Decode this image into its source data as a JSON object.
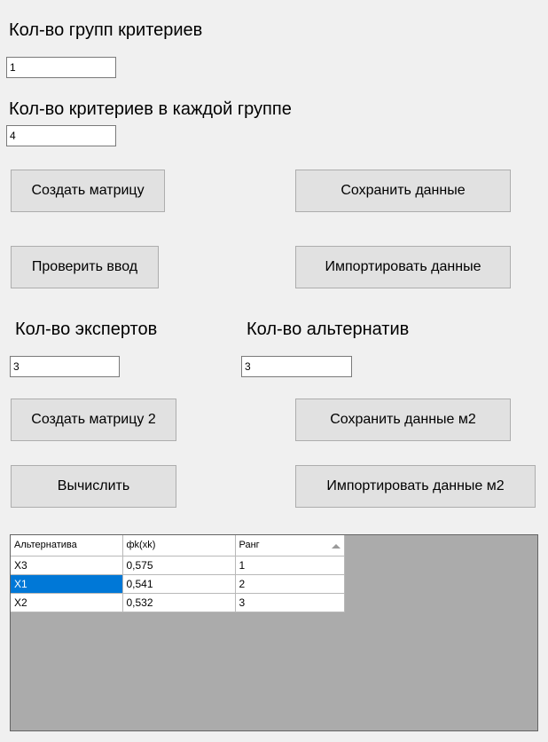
{
  "groups": {
    "label": "Кол-во групп критериев",
    "value": "1"
  },
  "criteria": {
    "label": "Кол-во критериев в каждой группе",
    "value": "4"
  },
  "buttons": {
    "create_matrix": "Создать матрицу",
    "save_data": "Сохранить данные",
    "check_input": "Проверить ввод",
    "import_data": "Импортировать данные",
    "create_matrix2": "Создать матрицу 2",
    "save_data_m2": "Сохранить данные м2",
    "calculate": "Вычислить",
    "import_data_m2": "Импортировать данные м2"
  },
  "experts": {
    "label": "Кол-во экспертов",
    "value": "3"
  },
  "alternatives": {
    "label": "Кол-во альтернатив",
    "value": "3"
  },
  "results": {
    "columns": [
      "Альтернатива",
      "фk(xk)",
      "Ранг"
    ],
    "sort_indicator": "sort-ascending-icon",
    "selected_row": 1,
    "rows": [
      [
        "X3",
        "0,575",
        "1"
      ],
      [
        "X1",
        "0,541",
        "2"
      ],
      [
        "X2",
        "0,532",
        "3"
      ]
    ]
  },
  "colors": {
    "selection": "#0078d7",
    "grid_background": "#ababab",
    "window_background": "#f0f0f0"
  }
}
